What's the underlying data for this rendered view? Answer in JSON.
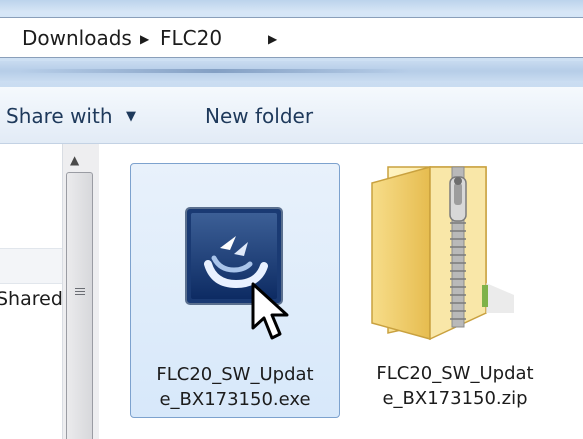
{
  "breadcrumb": {
    "items": [
      "Downloads",
      "FLC20"
    ]
  },
  "toolbar": {
    "share_label": "Share with",
    "new_folder_label": "New folder"
  },
  "nav": {
    "partial_item": "Shared"
  },
  "files": [
    {
      "name_line1": "FLC20_SW_Updat",
      "name_line2": "e_BX173150.exe",
      "type": "exe",
      "selected": true,
      "icon": "setup-app-icon"
    },
    {
      "name_line1": "FLC20_SW_Updat",
      "name_line2": "e_BX173150.zip",
      "type": "zip",
      "selected": false,
      "icon": "zip-folder-icon"
    }
  ],
  "colors": {
    "selection_fill": "#d7e8fa",
    "selection_border": "#7da2ce",
    "toolbar_text": "#1e395b"
  }
}
